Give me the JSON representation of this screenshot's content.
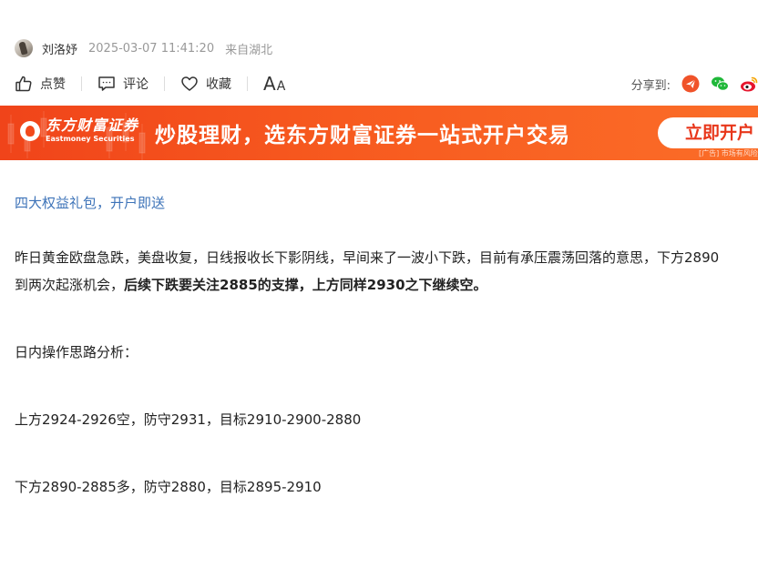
{
  "meta": {
    "author": "刘洛妤",
    "datetime": "2025-03-07 11:41:20",
    "location": "来自湖北"
  },
  "toolbar": {
    "like_label": "点赞",
    "comment_label": "评论",
    "favorite_label": "收藏",
    "font_big": "A",
    "font_small": "A",
    "share_label": "分享到:",
    "share_targets": [
      "toutiao-icon",
      "wechat-icon",
      "weibo-icon"
    ]
  },
  "banner": {
    "brand_cn": "东方财富证券",
    "brand_en": "Eastmoney Securities",
    "slogan": "炒股理财，选东方财富证券一站式开户交易",
    "button_label": "立即开户",
    "ad_tag": "[广告] 市场有风险"
  },
  "article": {
    "promo_link": "四大权益礼包，开户即送",
    "para1_line1": "昨日黄金欧盘急跌，美盘收复，日线报收长下影阴线，早间来了一波小下跌，目前有承压震荡回落的意思，下方2890",
    "para1_line2_normal": "到两次起涨机会，",
    "para1_line2_bold": "后续下跌要关注2885的支撑，上方同样2930之下继续空。",
    "analysis_heading": "日内操作思路分析：",
    "plan_short": "上方2924-2926空，防守2931，目标2910-2900-2880",
    "plan_long": "下方2890-2885多，防守2880，目标2895-2910"
  },
  "colors": {
    "banner_start": "#f0441a",
    "banner_end": "#fb6d28",
    "link": "#3d73b8",
    "wechat": "#20b83a",
    "toutiao": "#f0532a",
    "weibo": "#e6162d"
  }
}
